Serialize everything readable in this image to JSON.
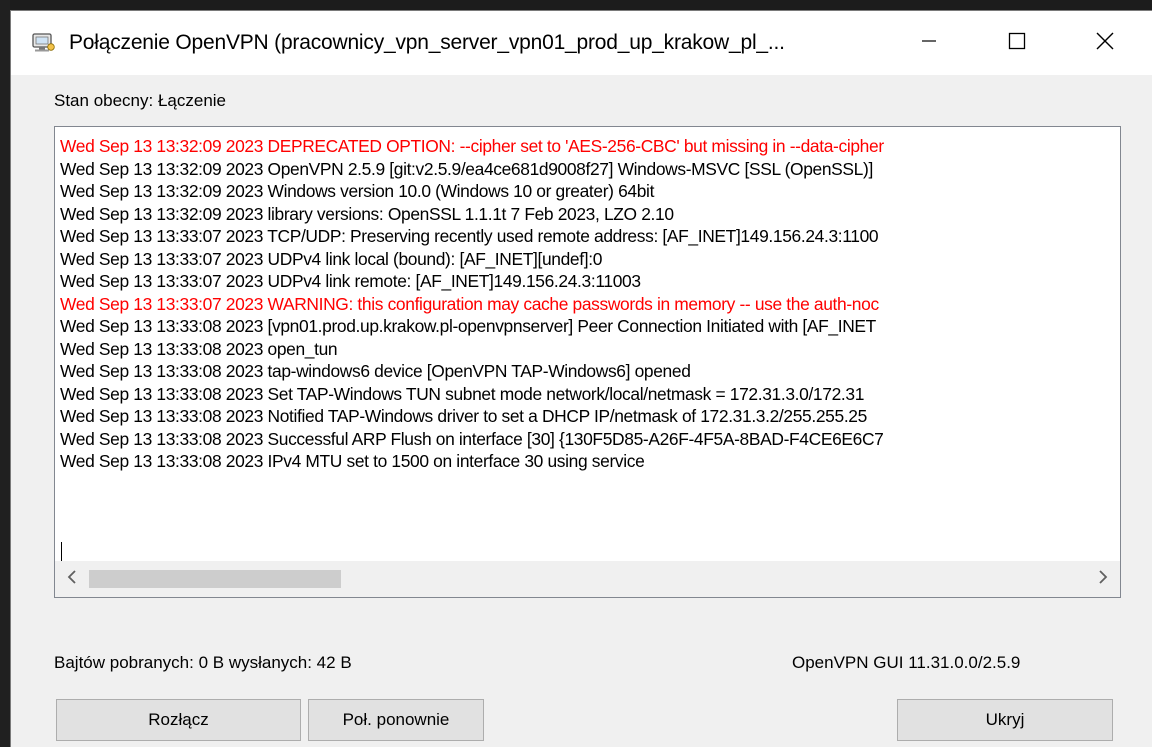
{
  "window": {
    "title": "Połączenie OpenVPN (pracownicy_vpn_server_vpn01_prod_up_krakow_pl_...",
    "icons": [
      "openvpn-app-icon",
      "minimize-icon",
      "maximize-icon",
      "close-icon"
    ]
  },
  "status": {
    "text": "Stan obecny: Łączenie"
  },
  "log": {
    "lines": [
      {
        "text": "Wed Sep 13 13:32:09 2023 DEPRECATED OPTION: --cipher set to 'AES-256-CBC' but missing in --data-cipher",
        "color": "#ff0000"
      },
      {
        "text": "Wed Sep 13 13:32:09 2023 OpenVPN 2.5.9 [git:v2.5.9/ea4ce681d9008f27] Windows-MSVC [SSL (OpenSSL)]",
        "color": "#000000"
      },
      {
        "text": "Wed Sep 13 13:32:09 2023 Windows version 10.0 (Windows 10 or greater) 64bit",
        "color": "#000000"
      },
      {
        "text": "Wed Sep 13 13:32:09 2023 library versions: OpenSSL 1.1.1t  7 Feb 2023, LZO 2.10",
        "color": "#000000"
      },
      {
        "text": "Wed Sep 13 13:33:07 2023 TCP/UDP: Preserving recently used remote address: [AF_INET]149.156.24.3:1100",
        "color": "#000000"
      },
      {
        "text": "Wed Sep 13 13:33:07 2023 UDPv4 link local (bound): [AF_INET][undef]:0",
        "color": "#000000"
      },
      {
        "text": "Wed Sep 13 13:33:07 2023 UDPv4 link remote: [AF_INET]149.156.24.3:11003",
        "color": "#000000"
      },
      {
        "text": "Wed Sep 13 13:33:07 2023 WARNING: this configuration may cache passwords in memory -- use the auth-noc",
        "color": "#ff0000"
      },
      {
        "text": "Wed Sep 13 13:33:08 2023 [vpn01.prod.up.krakow.pl-openvpnserver] Peer Connection Initiated with [AF_INET",
        "color": "#000000"
      },
      {
        "text": "Wed Sep 13 13:33:08 2023 open_tun",
        "color": "#000000"
      },
      {
        "text": "Wed Sep 13 13:33:08 2023 tap-windows6 device [OpenVPN TAP-Windows6] opened",
        "color": "#000000"
      },
      {
        "text": "Wed Sep 13 13:33:08 2023 Set TAP-Windows TUN subnet mode network/local/netmask = 172.31.3.0/172.31",
        "color": "#000000"
      },
      {
        "text": "Wed Sep 13 13:33:08 2023 Notified TAP-Windows driver to set a DHCP IP/netmask of 172.31.3.2/255.255.25",
        "color": "#000000"
      },
      {
        "text": "Wed Sep 13 13:33:08 2023 Successful ARP Flush on interface [30] {130F5D85-A26F-4F5A-8BAD-F4CE6E6C7",
        "color": "#000000"
      },
      {
        "text": "Wed Sep 13 13:33:08 2023 IPv4 MTU set to 1500 on interface 30 using service",
        "color": "#000000"
      }
    ],
    "scroll_icons": [
      "chevron-left-icon",
      "chevron-right-icon"
    ]
  },
  "footer": {
    "bytes_text": "Bajtów pobranych: 0 B  wysłanych: 42 B",
    "version_text": "OpenVPN GUI 11.31.0.0/2.5.9"
  },
  "buttons": {
    "disconnect": "Rozłącz",
    "reconnect": "Poł. ponownie",
    "hide": "Ukryj"
  },
  "colors": {
    "error_text": "#ff0000",
    "window_bg": "#f0f0f0",
    "titlebar_bg": "#ffffff",
    "button_bg": "#e1e1e1"
  }
}
